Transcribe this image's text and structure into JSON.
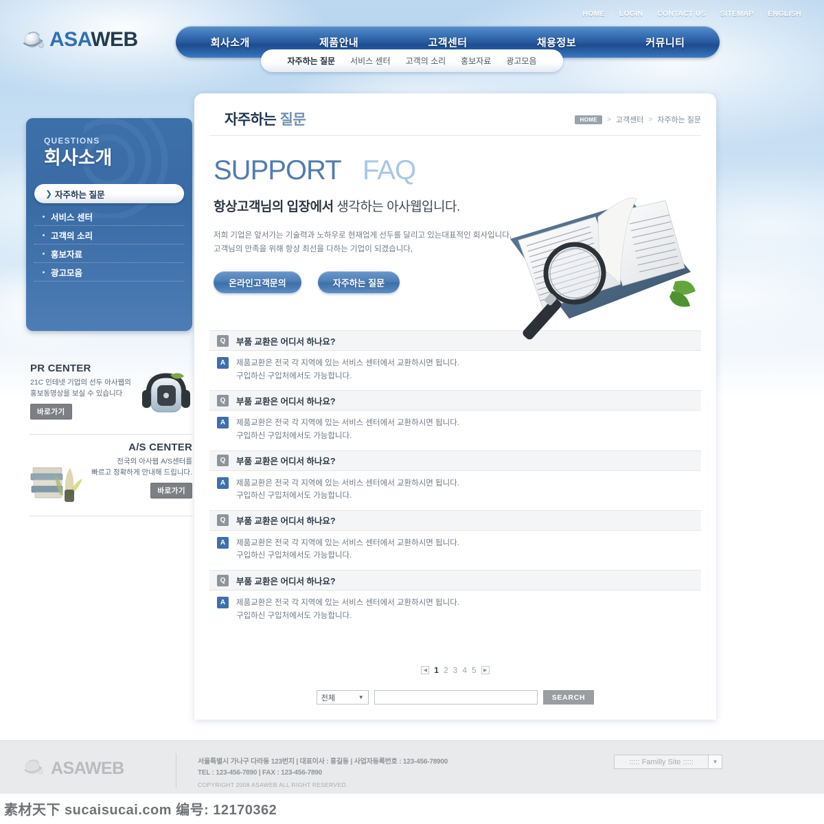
{
  "brand": {
    "name_a": "ASA",
    "name_b": "WEB",
    "logo_icon": "globe-arrow-icon"
  },
  "utility_nav": [
    {
      "label": "HOME"
    },
    {
      "label": "LOGIN"
    },
    {
      "label": "CONTACT US"
    },
    {
      "label": "SITEMAP"
    },
    {
      "label": "ENGLISH"
    }
  ],
  "main_nav": [
    {
      "label": "회사소개"
    },
    {
      "label": "제품안내"
    },
    {
      "label": "고객센터"
    },
    {
      "label": "채용정보"
    },
    {
      "label": "커뮤니티"
    }
  ],
  "sub_nav": [
    {
      "label": "자주하는 질문",
      "active": true
    },
    {
      "label": "서비스 센터",
      "active": false
    },
    {
      "label": "고객의 소리",
      "active": false
    },
    {
      "label": "홍보자료",
      "active": false
    },
    {
      "label": "광고모음",
      "active": false
    }
  ],
  "sidebar": {
    "eyebrow": "QUESTIONS",
    "title": "회사소개",
    "items": [
      {
        "label": "자주하는 질문",
        "active": true
      },
      {
        "label": "서비스 센터",
        "active": false
      },
      {
        "label": "고객의 소리",
        "active": false
      },
      {
        "label": "홍보자료",
        "active": false
      },
      {
        "label": "광고모음",
        "active": false
      }
    ],
    "banners": [
      {
        "title": "PR CENTER",
        "desc_line1": "21C 인테넷 기업의 선두 아사웹의",
        "desc_line2": "홍보동영상을 보실 수 있습니다",
        "button": "바로가기",
        "art": "headphone-robot-icon"
      },
      {
        "title": "A/S CENTER",
        "desc_line1": "전국의 아사웹 A/S센터를",
        "desc_line2": "빠르고 정확하게 안내해 드립니다.",
        "button": "바로가기",
        "art": "books-plant-icon"
      }
    ]
  },
  "page": {
    "title_bold": "자주하는",
    "title_light": "질문",
    "breadcrumb": {
      "home": "HOME",
      "items": [
        "고객센터",
        "자주하는 질문"
      ],
      "separator": ">"
    }
  },
  "hero": {
    "headline_dark": "SUPPORT",
    "headline_light": "FAQ",
    "subhead_bold": "항상고객님의 입장에서",
    "subhead_rest": " 생각하는 아사웹입니다.",
    "body_line1": "저희 기업은 앞서가는 기술력과 노하우로 현재업게 선두를 달리고 있는대표적인 회사입니다,",
    "body_line2": "고객님의 만족을 위해 항상 최선을 다하는 기업이 되겠습니다,",
    "buttons": [
      {
        "label": "온라인고객문의"
      },
      {
        "label": "자주하는 질문"
      }
    ],
    "art": "open-book-magnifier-icon"
  },
  "faq": {
    "q_badge": "Q",
    "a_badge": "A",
    "items": [
      {
        "question": "부품 교환은 어디서 하나요?",
        "answer_line1": "제품교환은 전국 각 지역에 있는 서비스 센터에서 교환하시면 됩니다.",
        "answer_line2": "구입하신 구입처에서도 가능합니다."
      },
      {
        "question": "부품 교환은 어디서 하나요?",
        "answer_line1": "제품교환은 전국 각 지역에 있는 서비스 센터에서 교환하시면 됩니다.",
        "answer_line2": "구입하신 구입처에서도 가능합니다."
      },
      {
        "question": "부품 교환은 어디서 하나요?",
        "answer_line1": "제품교환은 전국 각 지역에 있는 서비스 센터에서 교환하시면 됩니다.",
        "answer_line2": "구입하신 구입처에서도 가능합니다."
      },
      {
        "question": "부품 교환은 어디서 하나요?",
        "answer_line1": "제품교환은 전국 각 지역에 있는 서비스 센터에서 교환하시면 됩니다.",
        "answer_line2": "구입하신 구입처에서도 가능합니다."
      },
      {
        "question": "부품 교환은 어디서 하나요?",
        "answer_line1": "제품교환은 전국 각 지역에 있는 서비스 센터에서 교환하시면 됩니다.",
        "answer_line2": "구입하신 구입처에서도 가능합니다."
      }
    ]
  },
  "pagination": {
    "prev_icon": "◀",
    "next_icon": "▶",
    "pages": [
      "1",
      "2",
      "3",
      "4",
      "5"
    ],
    "current": "1"
  },
  "search": {
    "select_value": "전체",
    "input_value": "",
    "placeholder": "",
    "button": "SEARCH"
  },
  "footer": {
    "address": "서울특별시 가나구 다라동 123번지  |  대표이사 : 홍길동  |  사업자등록번호 : 123-456-78900",
    "contact": "TEL : 123-456-7890  |  FAX : 123-456-7890",
    "copyright": "COPYRIGHT 2008 ASAWEB ALL RIGHT RESERVED.",
    "family_site": "::::: Familly Site :::::"
  },
  "watermark": "素材天下 sucaisucai.com  编号: 12170362",
  "colors": {
    "nav_blue": "#27589d",
    "accent_blue": "#3f6fae",
    "sidebar_blue": "#3d6fa8",
    "headline_blue": "#4f7cae",
    "headline_light_blue": "#a6c8e8",
    "q_badge_gray": "#8d949b",
    "footer_bg": "#e9eaeb"
  }
}
